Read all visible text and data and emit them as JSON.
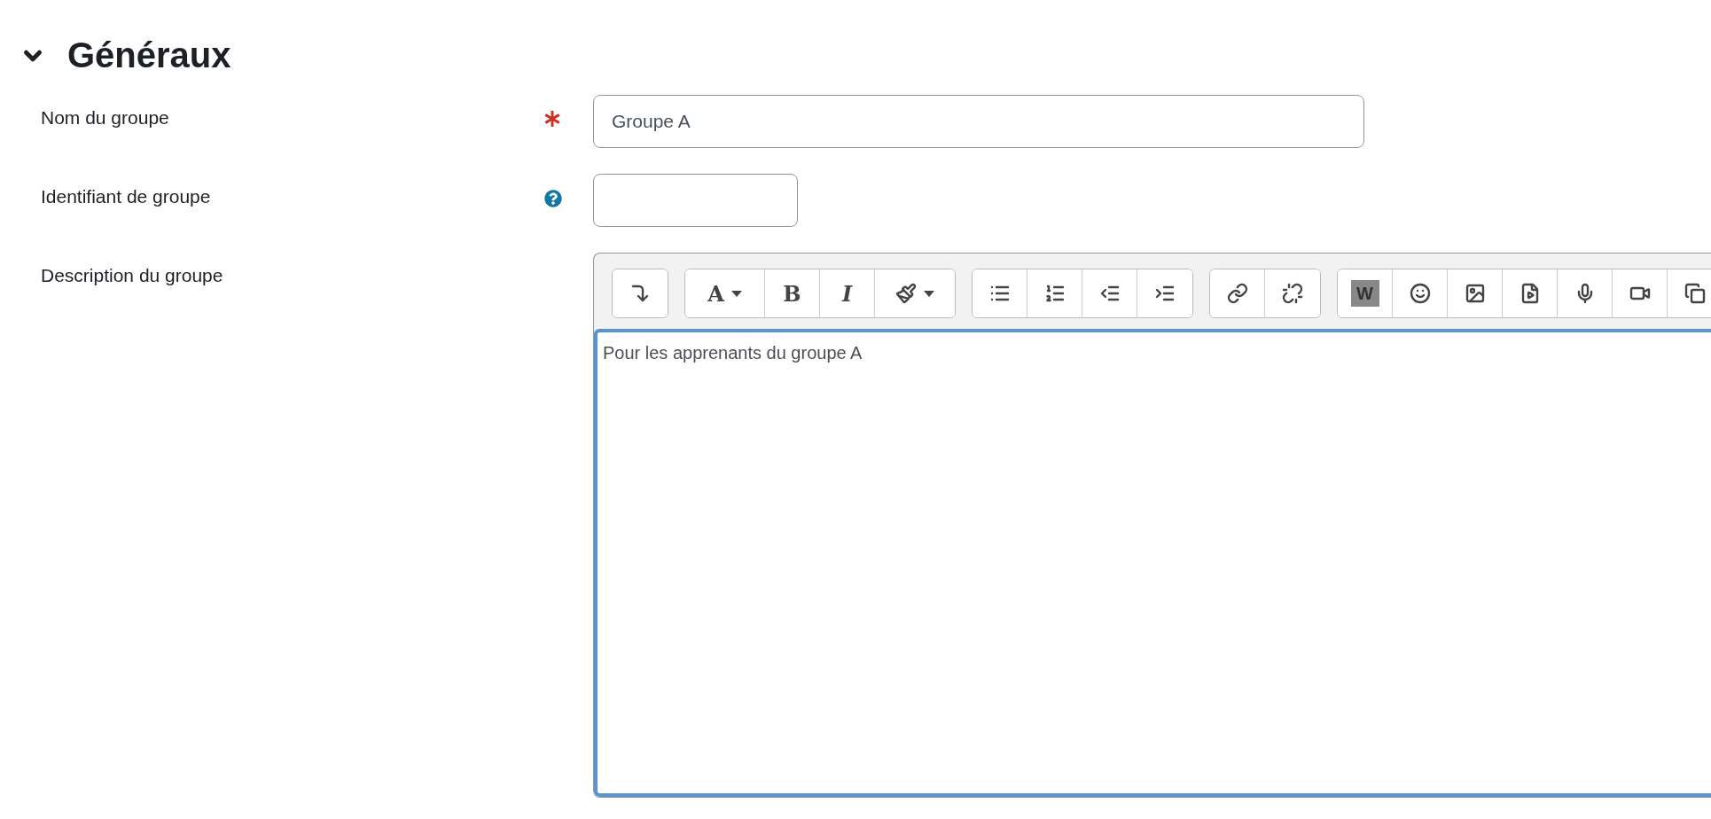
{
  "section": {
    "title": "Généraux",
    "expanded": true
  },
  "fields": [
    {
      "label": "Nom du groupe",
      "kind": "wide",
      "required": true,
      "help": false,
      "value": "Groupe A"
    },
    {
      "label": "Identifiant de groupe",
      "kind": "short",
      "required": false,
      "help": true
    }
  ],
  "editor": {
    "label": "Description du groupe",
    "focused": true,
    "content": "Pour les apprenants du groupe A",
    "toolbar": [
      [
        {
          "kind": "expand"
        }
      ],
      [
        {
          "kind": "font",
          "label": "A"
        },
        {
          "kind": "bold",
          "label": "B"
        },
        {
          "kind": "italic",
          "label": "I"
        },
        {
          "kind": "color"
        }
      ],
      [
        {
          "kind": "bullets"
        },
        {
          "kind": "numbers"
        },
        {
          "kind": "outdent"
        },
        {
          "kind": "indent"
        }
      ],
      [
        {
          "kind": "link"
        },
        {
          "kind": "unlink"
        }
      ],
      [
        {
          "kind": "word",
          "label": "W"
        },
        {
          "kind": "emoji"
        },
        {
          "kind": "image"
        },
        {
          "kind": "media"
        },
        {
          "kind": "audio"
        },
        {
          "kind": "video"
        },
        {
          "kind": "copy"
        }
      ]
    ]
  }
}
